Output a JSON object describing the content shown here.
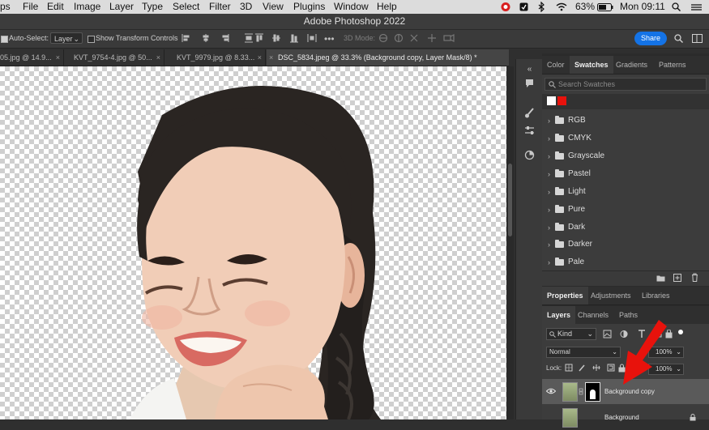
{
  "menubar": {
    "items": [
      "ps",
      "File",
      "Edit",
      "Image",
      "Layer",
      "Type",
      "Select",
      "Filter",
      "3D",
      "View",
      "Plugins",
      "Window",
      "Help"
    ],
    "battery": "63%",
    "clock": "Mon 09:11"
  },
  "window": {
    "title": "Adobe Photoshop 2022"
  },
  "options": {
    "auto_select_label": "Auto-Select:",
    "auto_select_value": "Layer",
    "show_transform_label": "Show Transform Controls",
    "mode_3d_label": "3D Mode:",
    "share_label": "Share"
  },
  "tabs": [
    {
      "label": "05.jpg @ 14.9...",
      "close": "×"
    },
    {
      "label": "KVT_9754-4.jpg @ 50...",
      "close": "×"
    },
    {
      "label": "KVT_9979.jpg @ 8.33...",
      "close": "×"
    },
    {
      "label": "DSC_5834.jpeg @ 33.3% (Background copy, Layer Mask/8) *",
      "close": "×"
    }
  ],
  "swatches_panel": {
    "tabs": [
      "Color",
      "Swatches",
      "Gradients",
      "Patterns"
    ],
    "active_tab": "Swatches",
    "search_placeholder": "Search Swatches",
    "recent_colors": [
      "#ffffff",
      "#e8120c"
    ],
    "groups": [
      "RGB",
      "CMYK",
      "Grayscale",
      "Pastel",
      "Light",
      "Pure",
      "Dark",
      "Darker",
      "Pale"
    ]
  },
  "properties_panel": {
    "tabs": [
      "Properties",
      "Adjustments",
      "Libraries"
    ]
  },
  "layers_panel": {
    "tabs": [
      "Layers",
      "Channels",
      "Paths"
    ],
    "filter_kind": "Kind",
    "blend_mode": "Normal",
    "opacity_value": "100%",
    "lock_label": "Lock:",
    "fill_value": "100%",
    "layers": [
      {
        "name": "Background copy",
        "selected": true
      },
      {
        "name": "Background",
        "selected": false
      }
    ]
  },
  "annotation": {
    "arrow_color": "#e8120c"
  }
}
